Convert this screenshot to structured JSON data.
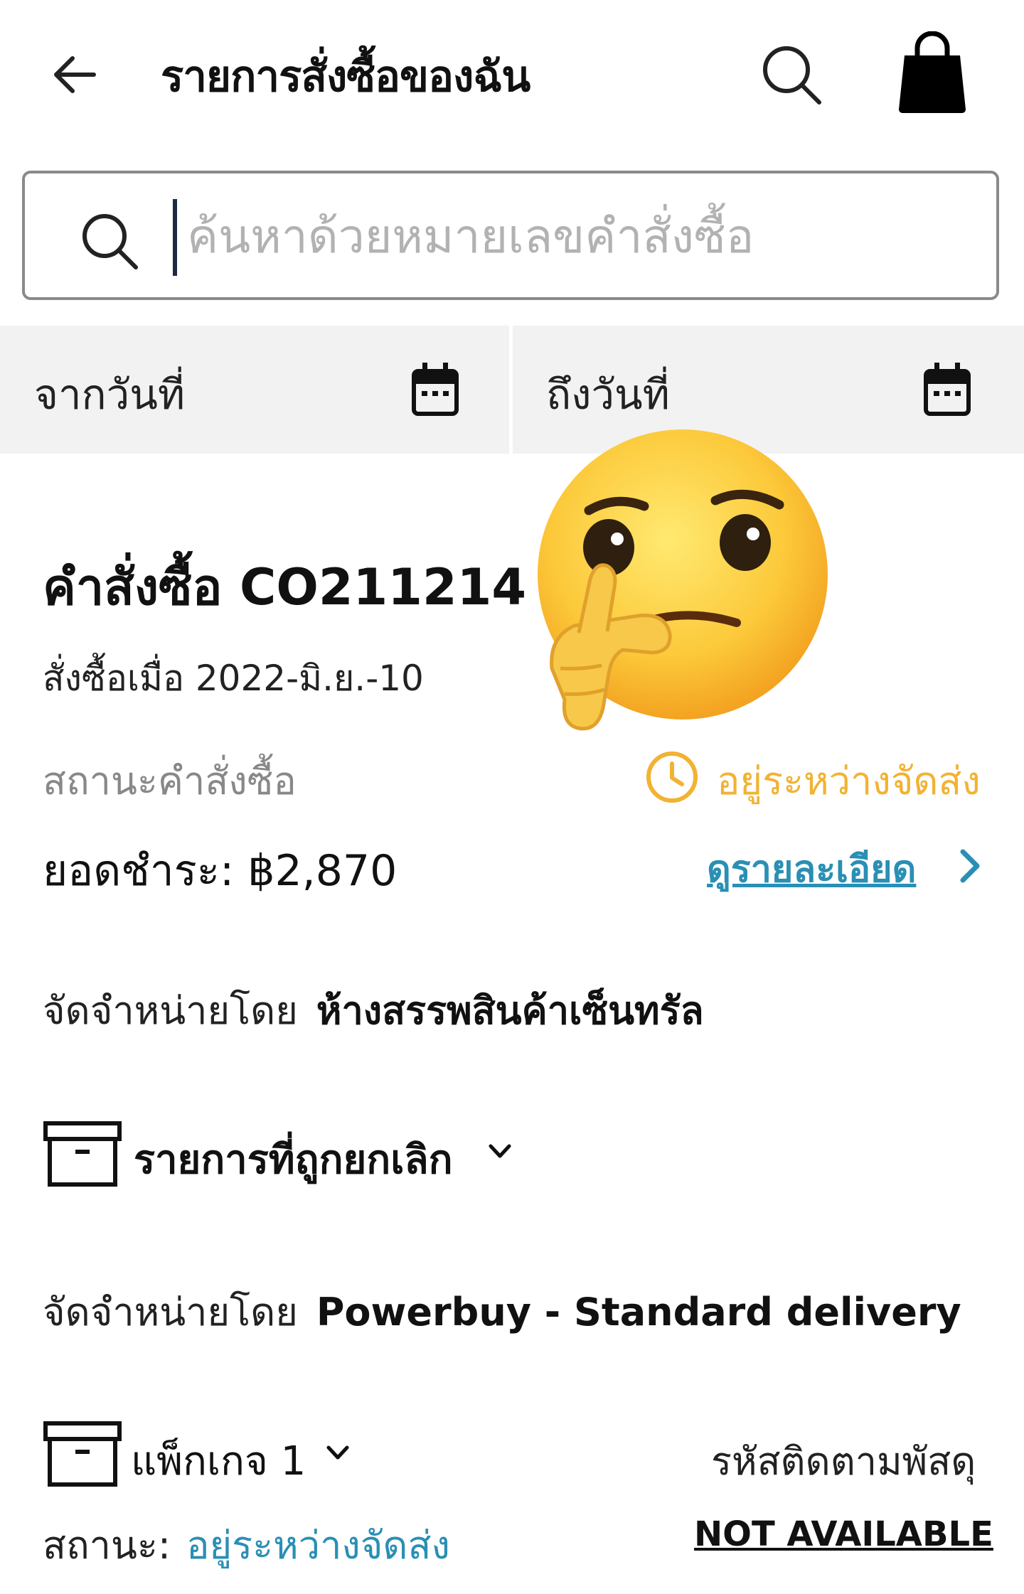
{
  "header": {
    "title": "รายการสั่งซื้อของฉัน",
    "back_icon": "arrow-left-icon",
    "search_icon": "search-icon",
    "cart_icon": "shopping-bag-icon"
  },
  "search": {
    "placeholder": "ค้นหาด้วยหมายเลขคำสั่งซื้อ",
    "value": ""
  },
  "date_filter": {
    "from_label": "จากวันที่",
    "to_label": "ถึงวันที่"
  },
  "order": {
    "title": "คำสั่งซื้อ CO211214",
    "date": "สั่งซื้อเมื่อ 2022-มิ.ย.-10",
    "status_label": "สถานะคำสั่งซื้อ",
    "status_value": "อยู่ระหว่างจัดส่ง",
    "total": "ยอดชำระ: ฿2,870",
    "details_link": "ดูรายละเอียด"
  },
  "seller1": {
    "label": "จัดจำหน่ายโดย",
    "name": "ห้างสรรพสินค้าเซ็นทรัล"
  },
  "cancelled": {
    "label": "รายการที่ถูกยกเลิก"
  },
  "seller2": {
    "label": "จัดจำหน่ายโดย",
    "name": "Powerbuy - Standard delivery"
  },
  "package": {
    "label": "แพ็กเกจ 1",
    "tracking_label": "รหัสติดตามพัสดุ",
    "status_prefix": "สถานะ:",
    "status_value": "อยู่ระหว่างจัดส่ง",
    "tracking_value": "NOT AVAILABLE"
  },
  "colors": {
    "accent_blue": "#2a8fb4",
    "status_orange": "#f2b233",
    "emoji": "thinking-face-emoji"
  }
}
